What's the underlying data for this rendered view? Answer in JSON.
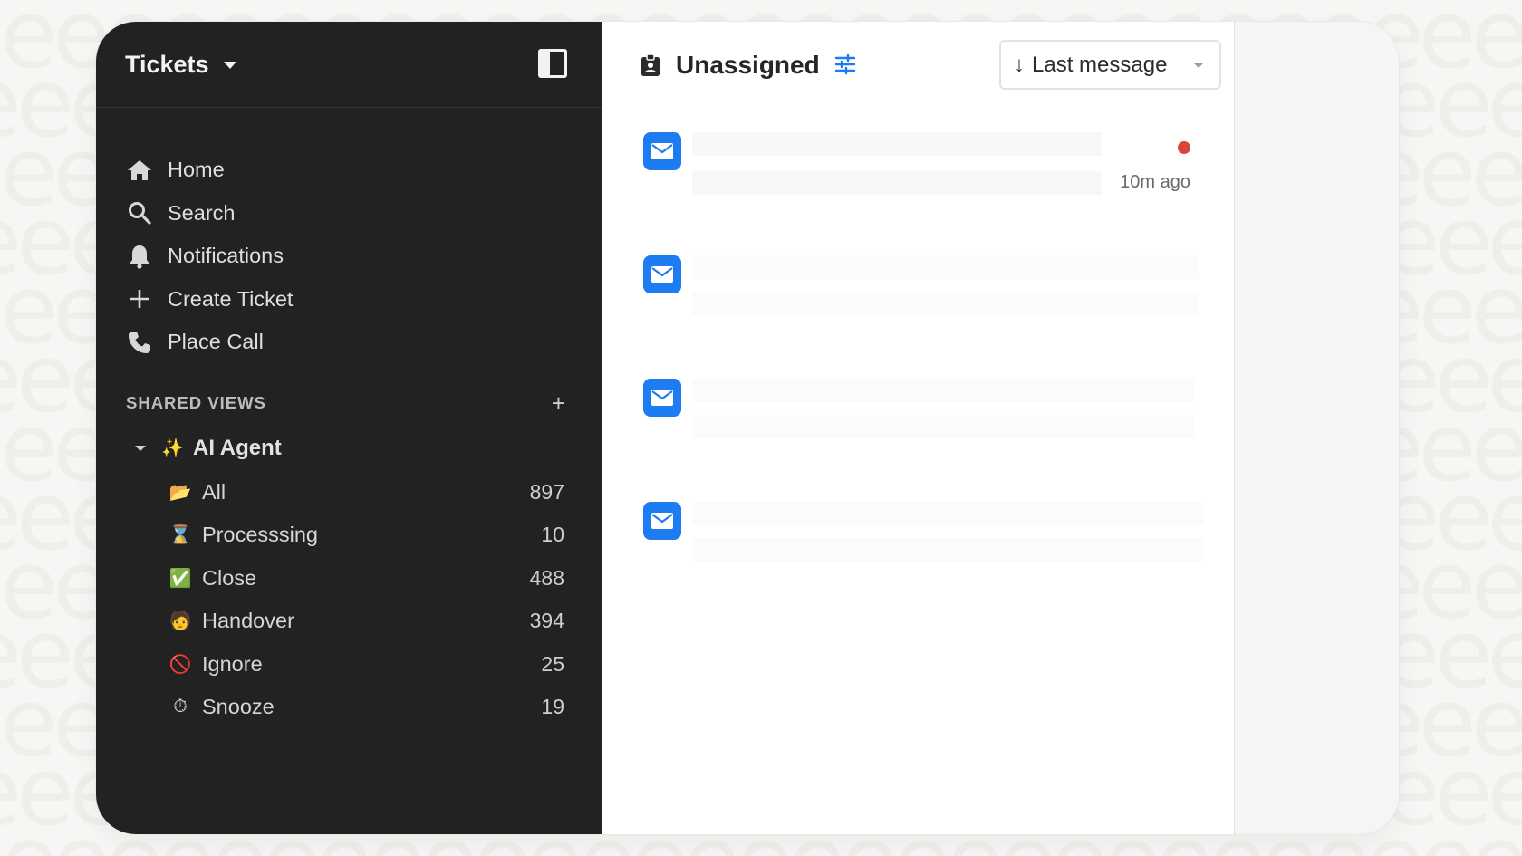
{
  "sidebar": {
    "title": "Tickets",
    "nav": [
      {
        "label": "Home",
        "icon": "home-icon"
      },
      {
        "label": "Search",
        "icon": "search-icon"
      },
      {
        "label": "Notifications",
        "icon": "bell-icon"
      },
      {
        "label": "Create Ticket",
        "icon": "plus-icon"
      },
      {
        "label": "Place Call",
        "icon": "phone-icon"
      }
    ],
    "shared_views": {
      "label": "SHARED VIEWS",
      "add_symbol": "+",
      "group": {
        "label": "AI Agent",
        "emoji": "✨",
        "views": [
          {
            "label": "All",
            "emoji": "📂",
            "count": "897"
          },
          {
            "label": "Processsing",
            "emoji": "⌛",
            "count": "10"
          },
          {
            "label": "Close",
            "emoji": "✅",
            "count": "488"
          },
          {
            "label": "Handover",
            "emoji": "🧑",
            "count": "394"
          },
          {
            "label": "Ignore",
            "emoji": "🚫",
            "count": "25"
          },
          {
            "label": "Snooze",
            "emoji": "⏱",
            "count": "19"
          }
        ]
      }
    }
  },
  "main": {
    "title": "Unassigned",
    "sort": {
      "arrow": "↓",
      "label": "Last message"
    },
    "tickets": [
      {
        "time": "10m ago",
        "unread": true
      },
      {
        "time": "",
        "unread": false
      },
      {
        "time": "",
        "unread": false
      },
      {
        "time": "",
        "unread": false
      }
    ]
  },
  "colors": {
    "sidebar_bg": "#222222",
    "accent_blue": "#1d7cf2",
    "unread_red": "#d9453a"
  }
}
